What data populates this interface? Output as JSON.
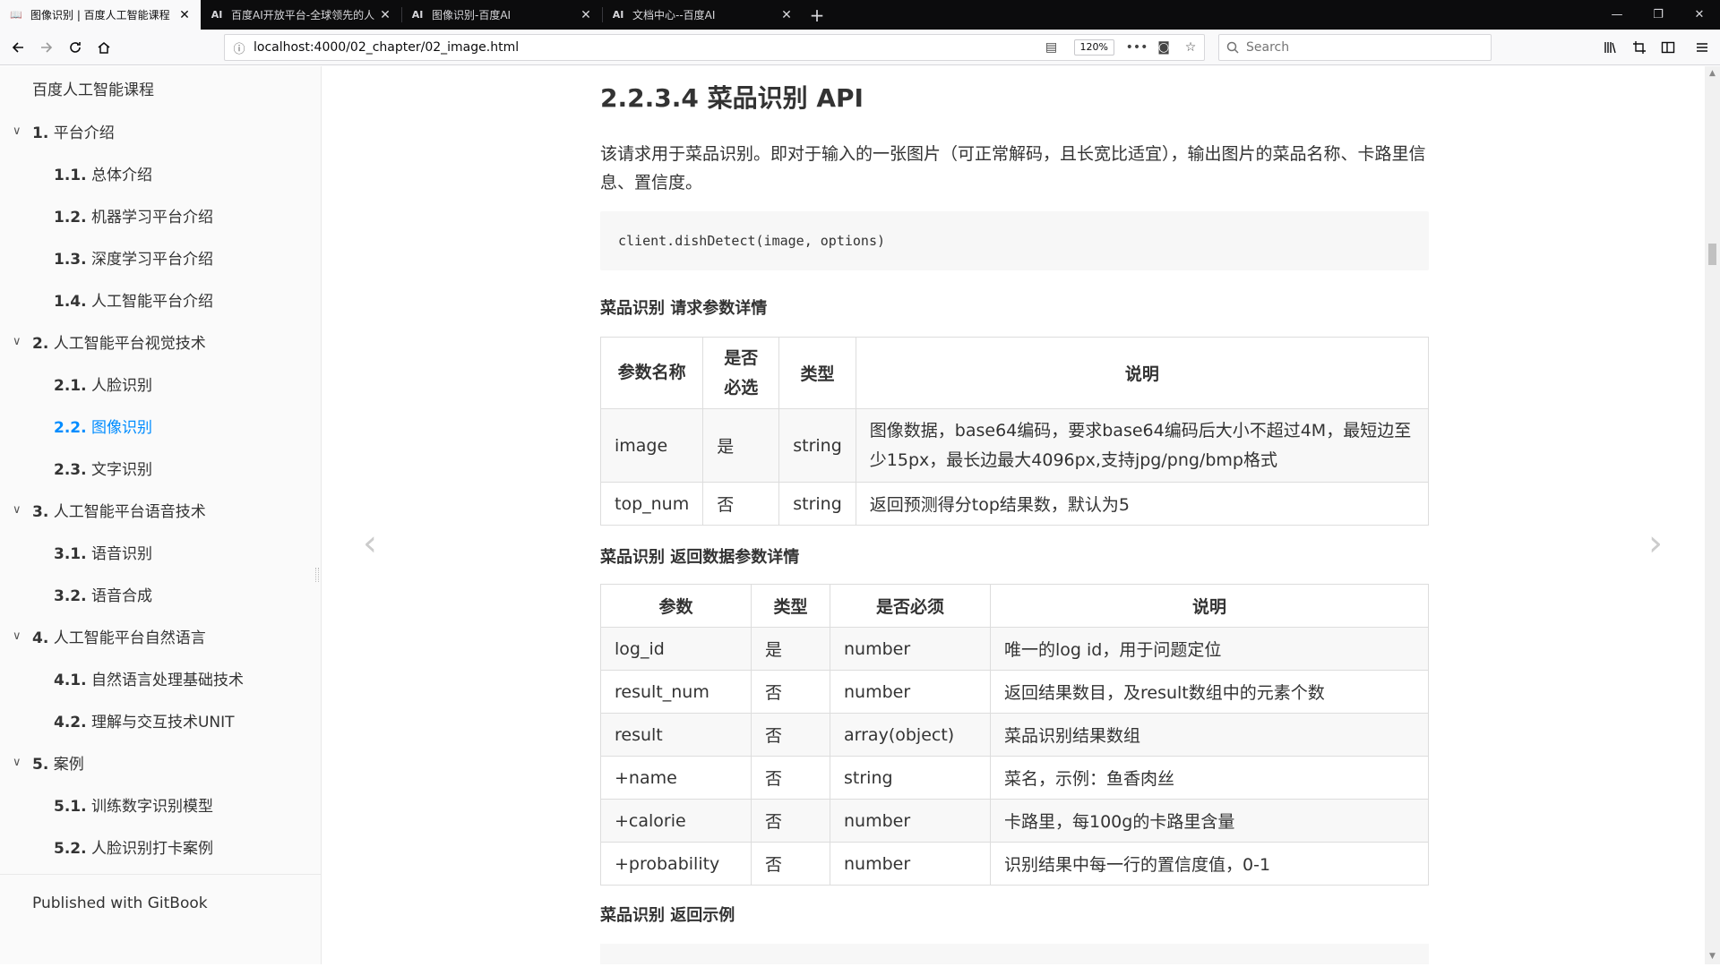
{
  "browser": {
    "tabs": [
      {
        "favicon": "book-icon",
        "title": "图像识别 | 百度人工智能课程",
        "active": true
      },
      {
        "favicon": "AI",
        "title": "百度AI开放平台-全球领先的人",
        "active": false
      },
      {
        "favicon": "AI",
        "title": "图像识别-百度AI",
        "active": false
      },
      {
        "favicon": "AI",
        "title": "文档中心--百度AI",
        "active": false
      }
    ],
    "url": "localhost:4000/02_chapter/02_image.html",
    "zoom": "120%",
    "search_placeholder": "Search"
  },
  "sidebar": {
    "title": "百度人工智能课程",
    "chapters": [
      {
        "num": "1.",
        "label": "平台介绍",
        "sections": [
          {
            "num": "1.1.",
            "label": "总体介绍"
          },
          {
            "num": "1.2.",
            "label": "机器学习平台介绍"
          },
          {
            "num": "1.3.",
            "label": "深度学习平台介绍"
          },
          {
            "num": "1.4.",
            "label": "人工智能平台介绍"
          }
        ]
      },
      {
        "num": "2.",
        "label": "人工智能平台视觉技术",
        "sections": [
          {
            "num": "2.1.",
            "label": "人脸识别"
          },
          {
            "num": "2.2.",
            "label": "图像识别",
            "active": true
          },
          {
            "num": "2.3.",
            "label": "文字识别"
          }
        ]
      },
      {
        "num": "3.",
        "label": "人工智能平台语音技术",
        "sections": [
          {
            "num": "3.1.",
            "label": "语音识别"
          },
          {
            "num": "3.2.",
            "label": "语音合成"
          }
        ]
      },
      {
        "num": "4.",
        "label": "人工智能平台自然语言",
        "sections": [
          {
            "num": "4.1.",
            "label": "自然语言处理基础技术"
          },
          {
            "num": "4.2.",
            "label": "理解与交互技术UNIT"
          }
        ]
      },
      {
        "num": "5.",
        "label": "案例",
        "sections": [
          {
            "num": "5.1.",
            "label": "训练数字识别模型"
          },
          {
            "num": "5.2.",
            "label": "人脸识别打卡案例"
          }
        ]
      }
    ],
    "footer": "Published with GitBook"
  },
  "article": {
    "heading": "2.2.3.4 菜品识别 API",
    "description": "该请求用于菜品识别。即对于输入的一张图片（可正常解码，且长宽比适宜），输出图片的菜品名称、卡路里信息、置信度。",
    "code": "client.dishDetect(image, options)",
    "req_heading": "菜品识别 请求参数详情",
    "req_table": {
      "headers": [
        "参数名称",
        "是否必选",
        "类型",
        "说明"
      ],
      "rows": [
        [
          "image",
          "是",
          "string",
          "图像数据，base64编码，要求base64编码后大小不超过4M，最短边至少15px，最长边最大4096px,支持jpg/png/bmp格式"
        ],
        [
          "top_num",
          "否",
          "string",
          "返回预测得分top结果数，默认为5"
        ]
      ]
    },
    "resp_heading": "菜品识别 返回数据参数详情",
    "resp_table": {
      "headers": [
        "参数",
        "类型",
        "是否必须",
        "说明"
      ],
      "rows": [
        [
          "log_id",
          "是",
          "number",
          "唯一的log id，用于问题定位"
        ],
        [
          "result_num",
          "否",
          "number",
          "返回结果数目，及result数组中的元素个数"
        ],
        [
          "result",
          "否",
          "array(object)",
          "菜品识别结果数组"
        ],
        [
          "+name",
          "否",
          "string",
          "菜名，示例：鱼香肉丝"
        ],
        [
          "+calorie",
          "否",
          "number",
          "卡路里，每100g的卡路里含量"
        ],
        [
          "+probability",
          "否",
          "number",
          "识别结果中每一行的置信度值，0-1"
        ]
      ]
    },
    "example_heading": "菜品识别 返回示例"
  }
}
